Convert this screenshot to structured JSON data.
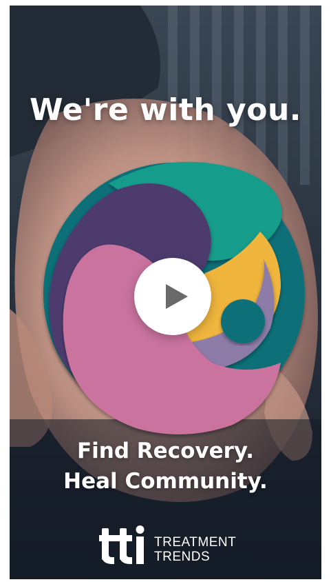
{
  "headline": "We're with you.",
  "tagline": {
    "line1": "Find Recovery.",
    "line2": "Heal Community."
  },
  "brand": {
    "mark_text": "tti",
    "name_line1": "TREATMENT",
    "name_line2": "TRENDS"
  },
  "colors": {
    "pink": "#c9739e",
    "purple": "#4d3a6e",
    "teal": "#159c8a",
    "dark_teal": "#0c6f79",
    "yellow": "#f0b53e",
    "lavender": "#8d7ba7"
  },
  "icons": {
    "play": "play-icon"
  }
}
